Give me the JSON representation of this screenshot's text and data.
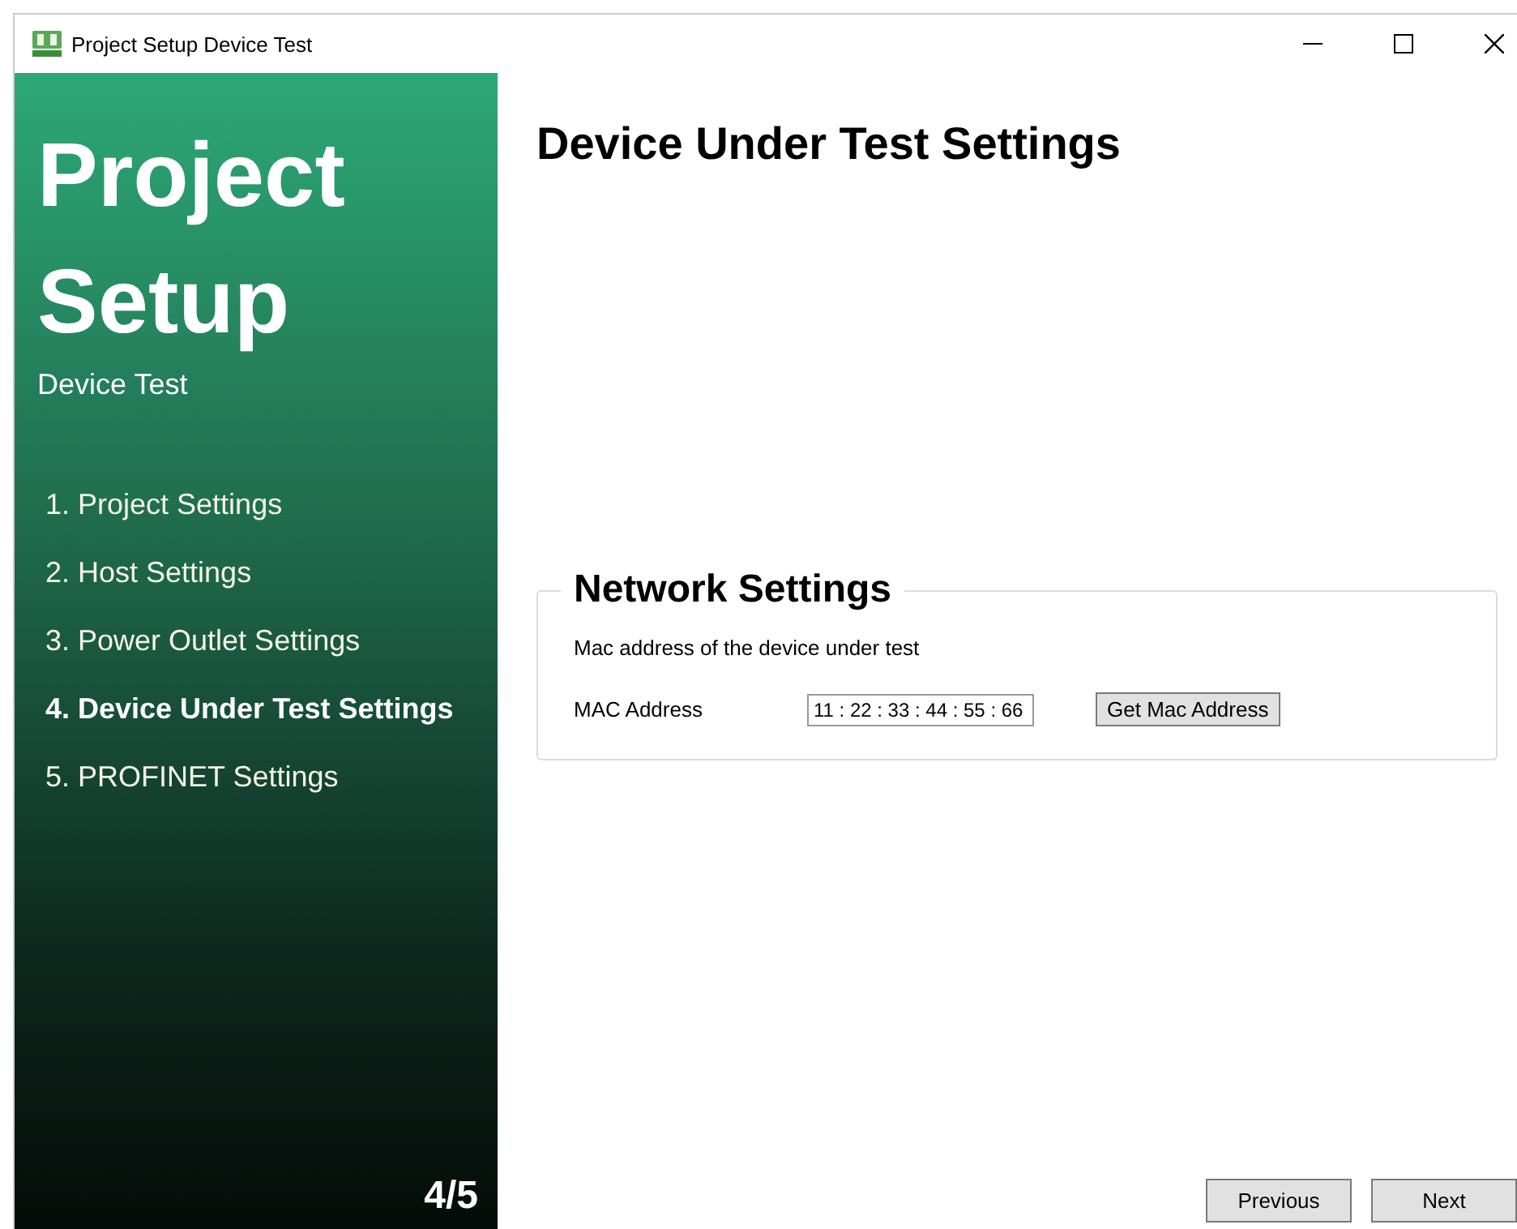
{
  "window": {
    "title": "Project Setup Device Test"
  },
  "sidebar": {
    "title_lines": [
      "Project",
      "Setup"
    ],
    "subtitle": "Device Test",
    "steps": [
      {
        "label": "1. Project Settings",
        "selected": false
      },
      {
        "label": "2. Host Settings",
        "selected": false
      },
      {
        "label": "3. Power Outlet Settings",
        "selected": false
      },
      {
        "label": "4. Device Under Test Settings",
        "selected": true
      },
      {
        "label": "5. PROFINET Settings",
        "selected": false
      }
    ],
    "progress": "4/5"
  },
  "page": {
    "heading": "Device Under Test Settings",
    "group": {
      "legend": "Network Settings",
      "description": "Mac address of the device under test",
      "field_label": "MAC Address",
      "value": "11 : 22 : 33 : 44 : 55 : 66",
      "button": "Get Mac Address"
    }
  },
  "buttons": [
    "Previous",
    "Next"
  ]
}
